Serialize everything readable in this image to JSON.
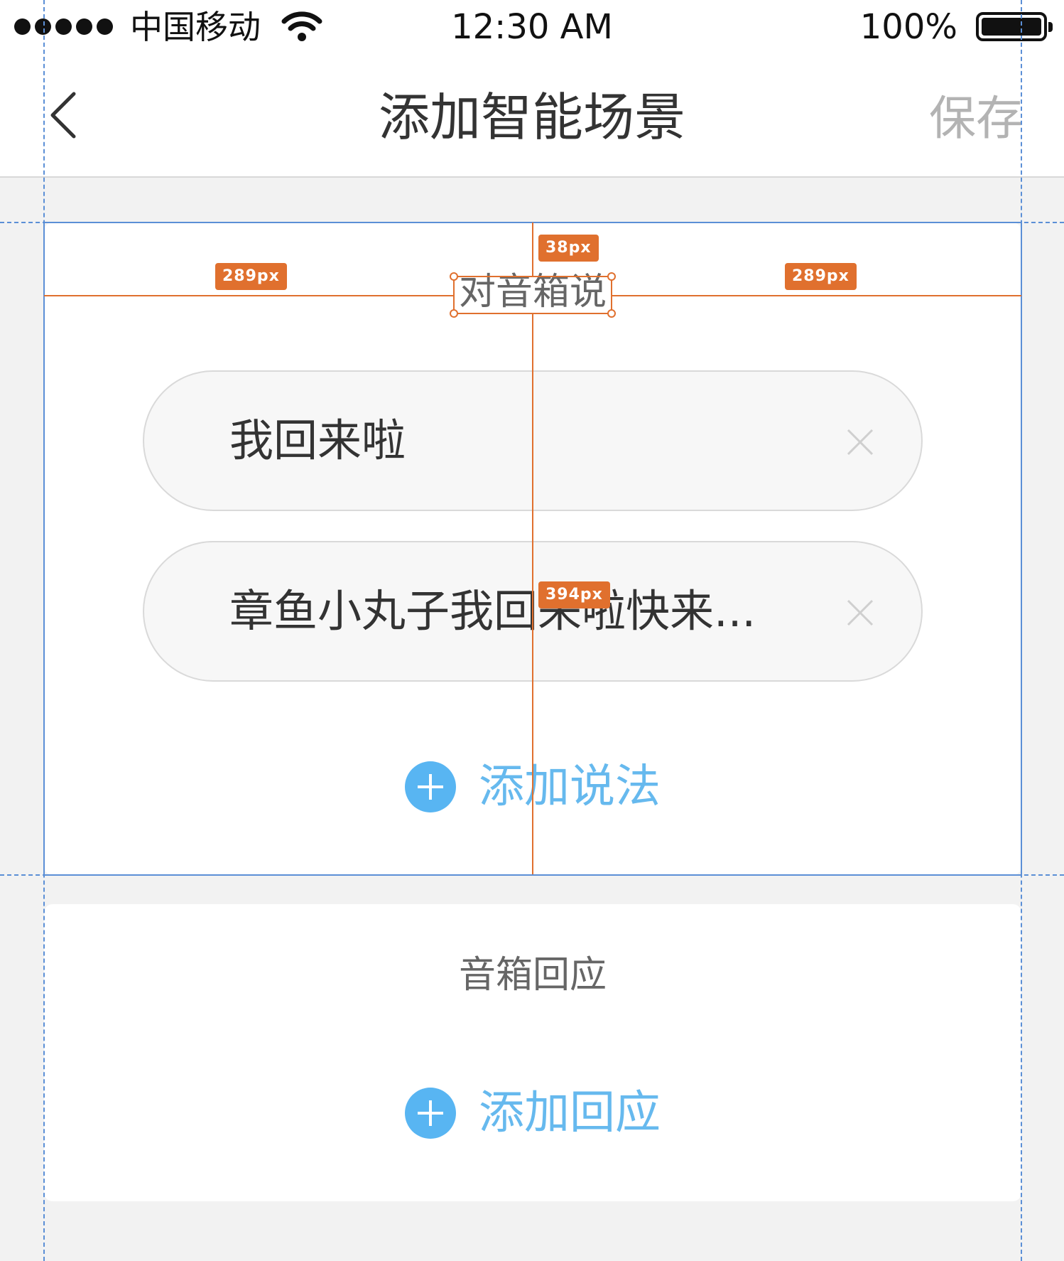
{
  "status_bar": {
    "carrier": "中国移动",
    "time": "12:30 AM",
    "battery": "100%"
  },
  "nav": {
    "title": "添加智能场景",
    "save_label": "保存"
  },
  "trigger_card": {
    "title": "对音箱说",
    "phrases": [
      "我回来啦",
      "章鱼小丸子我回来啦快来..."
    ],
    "add_label": "添加说法"
  },
  "response_card": {
    "title": "音箱回应",
    "add_label": "添加回应"
  },
  "annotations": {
    "left_gap": "289px",
    "right_gap": "289px",
    "top_gap": "38px",
    "bottom_gap": "394px"
  },
  "colors": {
    "accent": "#58b5f2",
    "accent_text": "#66b9ee",
    "measure": "#e0702e",
    "guide": "#5b8fd6",
    "background": "#f2f2f2"
  },
  "icons": {
    "back": "chevron-left-icon",
    "clear": "close-icon",
    "add": "plus-circle-icon",
    "wifi": "wifi-icon",
    "battery": "battery-icon"
  }
}
